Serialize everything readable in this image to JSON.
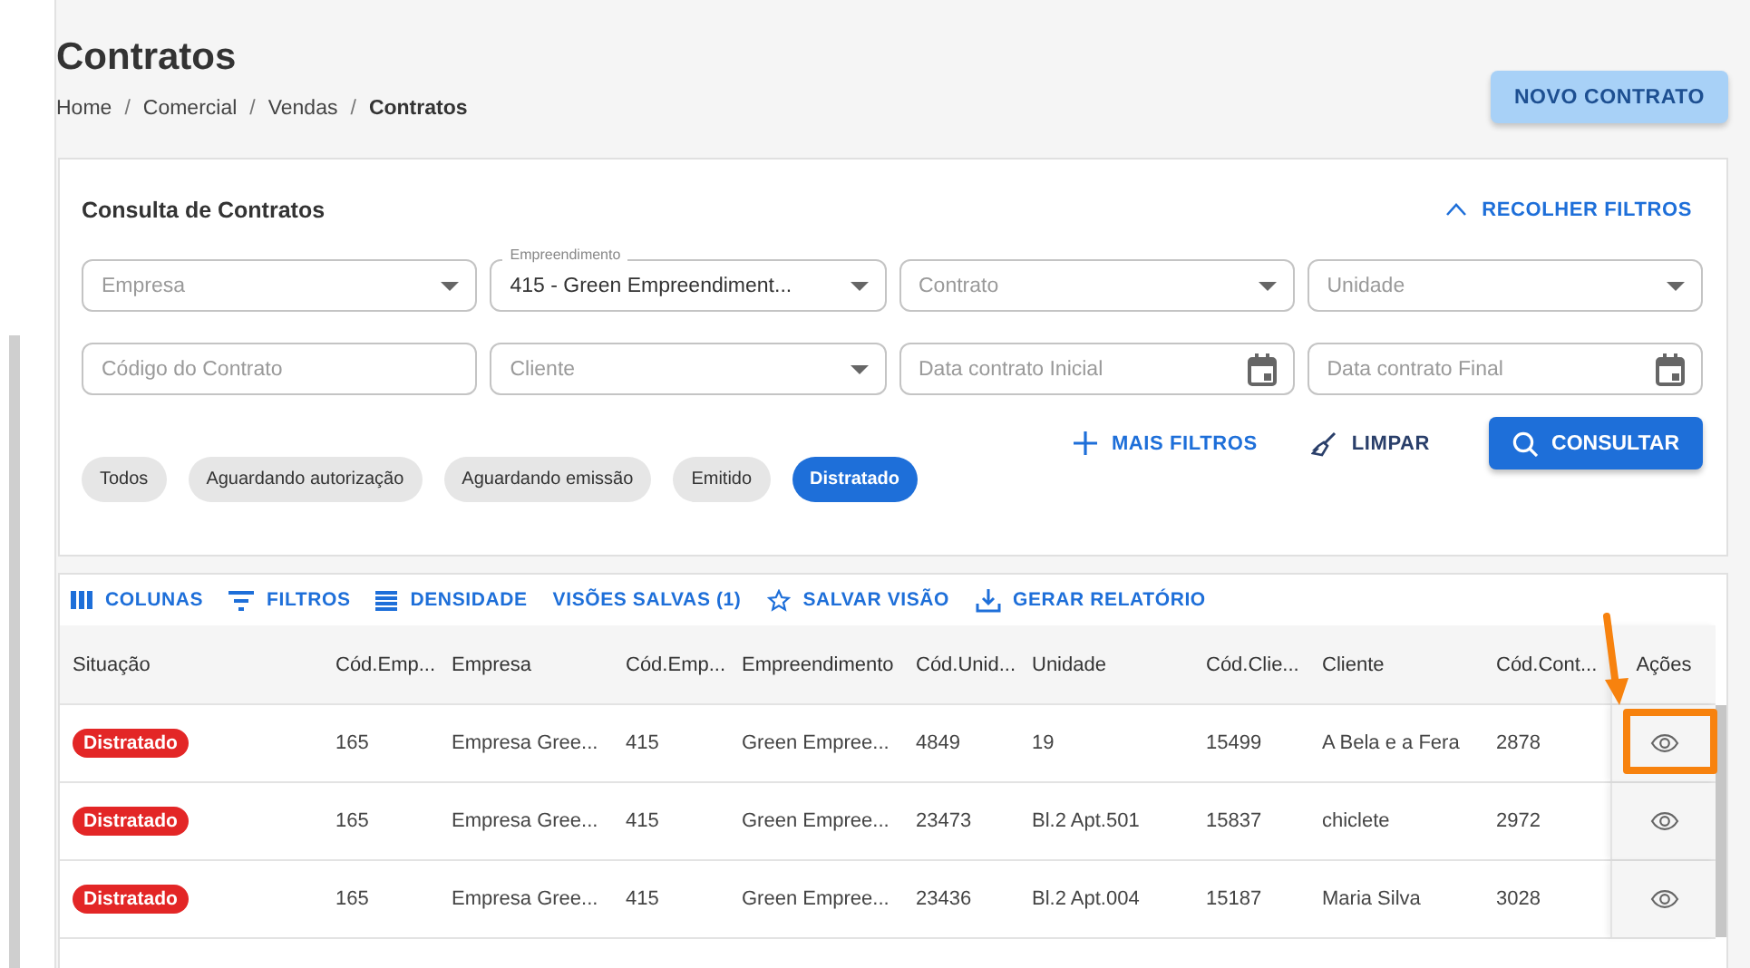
{
  "page": {
    "title": "Contratos",
    "breadcrumb_separator": "/",
    "breadcrumb": [
      {
        "label": "Home",
        "current": false
      },
      {
        "label": "Comercial",
        "current": false
      },
      {
        "label": "Vendas",
        "current": false
      },
      {
        "label": "Contratos",
        "current": true
      }
    ],
    "primary_button": "NOVO CONTRATO"
  },
  "filters": {
    "title": "Consulta de Contratos",
    "collapse_link": "RECOLHER FILTROS",
    "fields": [
      {
        "kind": "select",
        "placeholder": "Empresa"
      },
      {
        "kind": "select",
        "label": "Empreendimento",
        "value": "415 - Green Empreendiment..."
      },
      {
        "kind": "select",
        "placeholder": "Contrato"
      },
      {
        "kind": "select",
        "placeholder": "Unidade"
      },
      {
        "kind": "text",
        "placeholder": "Código do Contrato"
      },
      {
        "kind": "select",
        "placeholder": "Cliente"
      },
      {
        "kind": "date",
        "placeholder": "Data contrato Inicial"
      },
      {
        "kind": "date",
        "placeholder": "Data contrato Final"
      }
    ],
    "actions": [
      {
        "kind": "more",
        "label": "MAIS FILTROS"
      },
      {
        "kind": "clear",
        "label": "LIMPAR"
      },
      {
        "kind": "search",
        "label": "CONSULTAR"
      }
    ],
    "chips": [
      {
        "label": "Todos",
        "selected": false
      },
      {
        "label": "Aguardando autorização",
        "selected": false
      },
      {
        "label": "Aguardando emissão",
        "selected": false
      },
      {
        "label": "Emitido",
        "selected": false
      },
      {
        "label": "Distratado",
        "selected": true
      }
    ]
  },
  "table": {
    "toolbar": [
      {
        "kind": "columns",
        "label": "COLUNAS"
      },
      {
        "kind": "filter",
        "label": "FILTROS"
      },
      {
        "kind": "density",
        "label": "DENSIDADE"
      },
      {
        "kind": "plain",
        "label": "VISÕES SALVAS (1)"
      },
      {
        "kind": "star",
        "label": "SALVAR VISÃO"
      },
      {
        "kind": "download",
        "label": "GERAR RELATÓRIO"
      }
    ],
    "columns": [
      "Situação",
      "Cód.Emp...",
      "Empresa",
      "Cód.Emp...",
      "Empreendimento",
      "Cód.Unid...",
      "Unidade",
      "Cód.Clie...",
      "Cliente",
      "Cód.Cont..."
    ],
    "actions_column": "Ações",
    "rows": [
      {
        "cells": [
          "Distratado",
          "165",
          "Empresa Gree...",
          "415",
          "Green Empree...",
          "4849",
          "19",
          "15499",
          "A Bela e a Fera",
          "2878"
        ]
      },
      {
        "cells": [
          "Distratado",
          "165",
          "Empresa Gree...",
          "415",
          "Green Empree...",
          "23473",
          "Bl.2 Apt.501",
          "15837",
          "chiclete",
          "2972"
        ]
      },
      {
        "cells": [
          "Distratado",
          "165",
          "Empresa Gree...",
          "415",
          "Green Empree...",
          "23436",
          "Bl.2 Apt.004",
          "15187",
          "Maria Silva",
          "3028"
        ]
      }
    ]
  }
}
